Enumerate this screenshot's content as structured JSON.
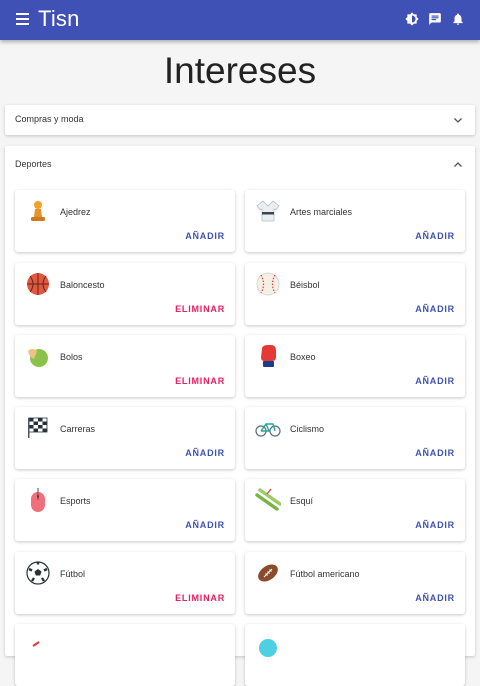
{
  "appbar": {
    "title": "Tisn",
    "color": "#3f51b5",
    "icons": [
      "menu-icon",
      "brightness-icon",
      "chat-icon",
      "bell-icon"
    ]
  },
  "page": {
    "title": "Intereses"
  },
  "sections": [
    {
      "label": "Compras y moda",
      "state": "collapsed"
    },
    {
      "label": "Deportes",
      "state": "expanded"
    }
  ],
  "actions": {
    "add": "AÑADIR",
    "remove": "ELIMINAR",
    "add_color": "#3f51b5",
    "remove_color": "#e91e63"
  },
  "cards": [
    {
      "label": "Ajedrez",
      "icon": "chess-pawn-icon",
      "action": "AÑADIR",
      "selected": false
    },
    {
      "label": "Artes marciales",
      "icon": "martial-arts-gi-icon",
      "action": "AÑADIR",
      "selected": false
    },
    {
      "label": "Baloncesto",
      "icon": "basketball-icon",
      "action": "ELIMINAR",
      "selected": true
    },
    {
      "label": "Béisbol",
      "icon": "baseball-icon",
      "action": "AÑADIR",
      "selected": false
    },
    {
      "label": "Bolos",
      "icon": "bowling-icon",
      "action": "ELIMINAR",
      "selected": true
    },
    {
      "label": "Boxeo",
      "icon": "boxing-glove-icon",
      "action": "AÑADIR",
      "selected": false
    },
    {
      "label": "Carreras",
      "icon": "checkered-flag-icon",
      "action": "AÑADIR",
      "selected": false
    },
    {
      "label": "Ciclismo",
      "icon": "bicycle-icon",
      "action": "AÑADIR",
      "selected": false
    },
    {
      "label": "Esports",
      "icon": "gaming-mouse-icon",
      "action": "AÑADIR",
      "selected": false
    },
    {
      "label": "Esquí",
      "icon": "skis-icon",
      "action": "AÑADIR",
      "selected": false
    },
    {
      "label": "Fútbol",
      "icon": "soccer-ball-icon",
      "action": "ELIMINAR",
      "selected": true
    },
    {
      "label": "Fútbol americano",
      "icon": "american-football-icon",
      "action": "AÑADIR",
      "selected": false
    }
  ]
}
